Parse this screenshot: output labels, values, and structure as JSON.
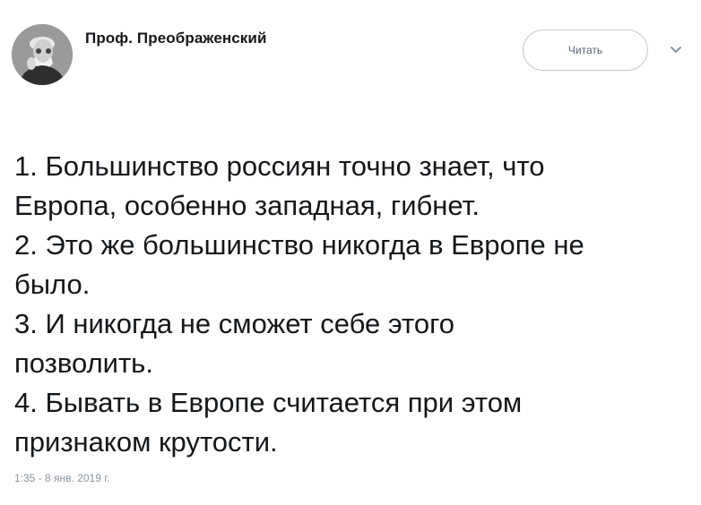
{
  "author": {
    "name": "Проф. Преображенский",
    "avatar_icon": "portrait-avatar"
  },
  "follow_button": {
    "label": "Читать"
  },
  "menu": {
    "icon": "chevron-down-icon"
  },
  "tweet": {
    "lines": [
      "1. Большинство россиян точно знает, что",
      "Европа, особенно западная, гибнет.",
      "2. Это же большинство никогда в Европе не",
      "было.",
      "3. И никогда не сможет себе этого",
      "позволить.",
      "4. Бывать в Европе считается при этом",
      "признаком крутости."
    ],
    "timestamp": "1:35 - 8 янв. 2019 г."
  },
  "colors": {
    "text": "#14171a",
    "muted": "#8a949d",
    "border": "#c6cbd0"
  }
}
